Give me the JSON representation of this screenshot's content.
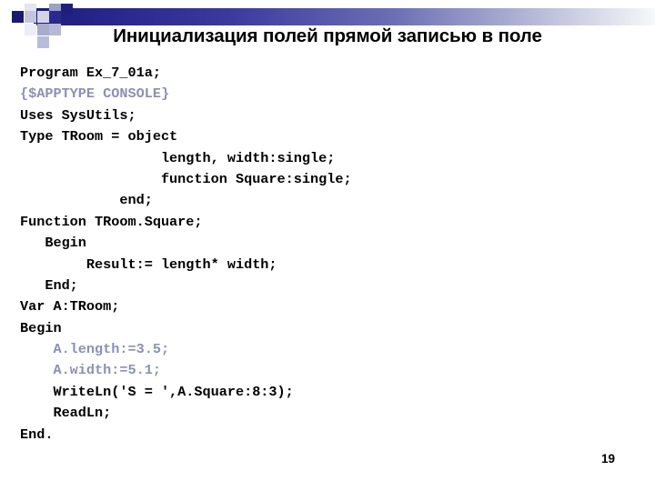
{
  "slide": {
    "title": "Инициализация полей прямой записью в поле",
    "page_number": "19",
    "colors": {
      "bar_start": "#1d1d7a",
      "bar_end": "#f7f8fb",
      "dim_text": "#8b90b6",
      "text": "#000000",
      "background": "#ffffff"
    }
  },
  "code": {
    "language": "pascal",
    "lines": [
      {
        "text": "Program Ex_7_01a;",
        "style": "normal"
      },
      {
        "text": "{$APPTYPE CONSOLE}",
        "style": "dim"
      },
      {
        "text": "Uses SysUtils;",
        "style": "normal"
      },
      {
        "text": "Type TRoom = object",
        "style": "normal"
      },
      {
        "text": "                 length, width:single;",
        "style": "normal"
      },
      {
        "text": "                 function Square:single;",
        "style": "normal"
      },
      {
        "text": "            end;",
        "style": "normal"
      },
      {
        "text": "Function TRoom.Square;",
        "style": "normal"
      },
      {
        "text": "   Begin",
        "style": "normal"
      },
      {
        "text": "        Result:= length* width;",
        "style": "normal"
      },
      {
        "text": "   End;",
        "style": "normal"
      },
      {
        "text": "Var A:TRoom;",
        "style": "normal"
      },
      {
        "text": "Begin",
        "style": "normal"
      },
      {
        "text": "    A.length:=3.5;",
        "style": "dim"
      },
      {
        "text": "    A.width:=5.1;",
        "style": "dim"
      },
      {
        "text": "    WriteLn('S = ',A.Square:8:3);",
        "style": "normal"
      },
      {
        "text": "    ReadLn;",
        "style": "normal"
      },
      {
        "text": "End.",
        "style": "normal"
      }
    ]
  },
  "decoration": {
    "squares": [
      {
        "name": "navy-square-1",
        "color": "#1a1a72"
      },
      {
        "name": "pale-square-1",
        "color": "#e4e5f0"
      },
      {
        "name": "pale-square-2",
        "color": "#eceef5"
      },
      {
        "name": "pale-square-3",
        "color": "#d3d5e6"
      },
      {
        "name": "mid-square-1",
        "color": "#a8abcc"
      },
      {
        "name": "mid-square-2",
        "color": "#c3c5de"
      },
      {
        "name": "mid-square-3",
        "color": "#9da1c6"
      },
      {
        "name": "mid-square-4",
        "color": "#b6b9d6"
      },
      {
        "name": "mid-square-5",
        "color": "#b9bcd9"
      },
      {
        "name": "navy-square-2",
        "color": "#2a2a8e"
      },
      {
        "name": "navy-square-3",
        "color": "#1e1e7e"
      }
    ]
  }
}
